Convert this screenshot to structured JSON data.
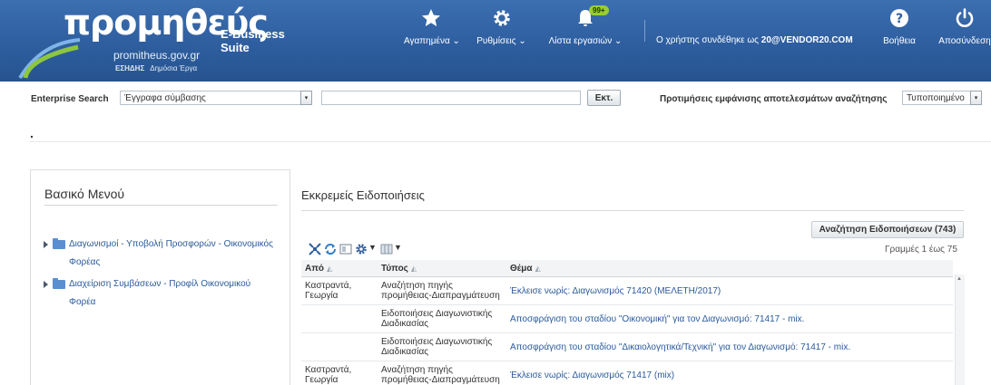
{
  "header": {
    "brand": "προμηθεύς",
    "brand_suffix": "E-Business Suite",
    "url": "promitheus.gov.gr",
    "sub_bold": "ΕΣΗΔΗΣ",
    "sub": "Δημόσια Έργα",
    "nav": {
      "favorites": "Αγαπημένα",
      "settings": "Ρυθμίσεις",
      "worklist": "Λίστα εργασιών",
      "worklist_badge": "99+",
      "help": "Βοήθεια",
      "logout": "Αποσύνδεση"
    },
    "user_prefix": "Ο χρήστης συνδέθηκε ως",
    "user": "20@VENDOR20.COM",
    "colors": {
      "bar": "#2e5e9f",
      "swoosh_green": "#8dc63f",
      "swoosh_blue": "#7fb4e8"
    }
  },
  "search": {
    "label": "Enterprise Search",
    "scope": "Έγγραφα σύμβασης",
    "query": "",
    "go": "Εκτ.",
    "prefs_label": "Προτιμήσεις εμφάνισης αποτελεσμάτων αναζήτησης",
    "prefs_value": "Τυποποιημένο"
  },
  "main_menu": {
    "title": "Βασικό Μενού",
    "items": [
      {
        "label": "Διαγωνισμοί - Υποβολή Προσφορών - Οικονομικός Φορέας"
      },
      {
        "label": "Διαχείριση Συμβάσεων - Προφίλ Οικονομικού Φορέα"
      }
    ]
  },
  "notifications": {
    "title": "Εκκρεμείς Ειδοποιήσεις",
    "search_button": "Αναζήτηση Ειδοποιήσεων (743)",
    "rows_label": "Γραμμές 1 έως 75",
    "columns": {
      "from": "Από",
      "type": "Τύπος",
      "subject": "Θέμα"
    },
    "rows": [
      {
        "from": "Καστραντά, Γεωργία",
        "type": "Αναζήτηση πηγής προμήθειας-Διαπραγμάτευση",
        "subject": "Έκλεισε νωρίς: Διαγωνισμός 71420 (ΜΕΛΕΤΗ/2017)"
      },
      {
        "from": "",
        "type": "Ειδοποιήσεις Διαγωνιστικής Διαδικασίας",
        "subject": "Αποσφράγιση του σταδίου \"Οικονομική\" για τον Διαγωνισμό: 71417 - mix."
      },
      {
        "from": "",
        "type": "Ειδοποιήσεις Διαγωνιστικής Διαδικασίας",
        "subject": "Αποσφράγιση του σταδίου \"Δικαιολογητικά/Τεχνική\" για τον Διαγωνισμό: 71417 - mix."
      },
      {
        "from": "Καστραντά, Γεωργία",
        "type": "Αναζήτηση πηγής προμήθειας-Διαπραγμάτευση",
        "subject": "Έκλεισε νωρίς: Διαγωνισμός 71417 (mix)"
      }
    ]
  }
}
